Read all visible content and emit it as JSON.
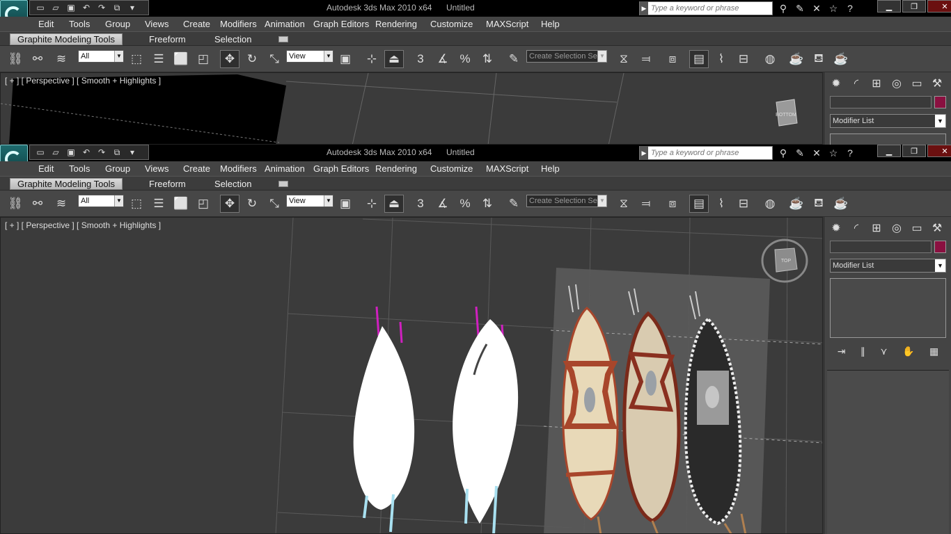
{
  "app": {
    "product_title": "Autodesk 3ds Max  2010 x64",
    "document_title": "Untitled",
    "search_placeholder": "Type a keyword or phrase"
  },
  "menu": [
    "Edit",
    "Tools",
    "Group",
    "Views",
    "Create",
    "Modifiers",
    "Animation",
    "Graph Editors",
    "Rendering",
    "Customize",
    "MAXScript",
    "Help"
  ],
  "ribbon": {
    "tabs": [
      "Graphite Modeling Tools",
      "Freeform",
      "Selection"
    ],
    "active": "Graphite Modeling Tools"
  },
  "toolbar": {
    "selection_filter": "All",
    "reference_coord": "View",
    "snap_toggle": "3",
    "named_selection_placeholder": "Create Selection Se"
  },
  "viewports": {
    "top": {
      "label": "[ + ] [ Perspective ] [ Smooth + Highlights ]",
      "viewcube_face": "BOTTOM"
    },
    "bottom": {
      "label": "[ + ] [ Perspective ] [ Smooth + Highlights ]",
      "viewcube_face": "TOP"
    }
  },
  "command_panel": {
    "modifier_list_label": "Modifier List",
    "object_color": "#8a1040",
    "tabs": [
      "create-icon",
      "modify-icon",
      "hierarchy-icon",
      "motion-icon",
      "display-icon",
      "utilities-icon"
    ]
  },
  "colors": {
    "viewport_bg": "#3b3b3b",
    "ui_bg": "#444444",
    "shield_a": "#e8d9b8",
    "shield_b": "#a8462b",
    "shield_c": "#2a2a2a"
  }
}
